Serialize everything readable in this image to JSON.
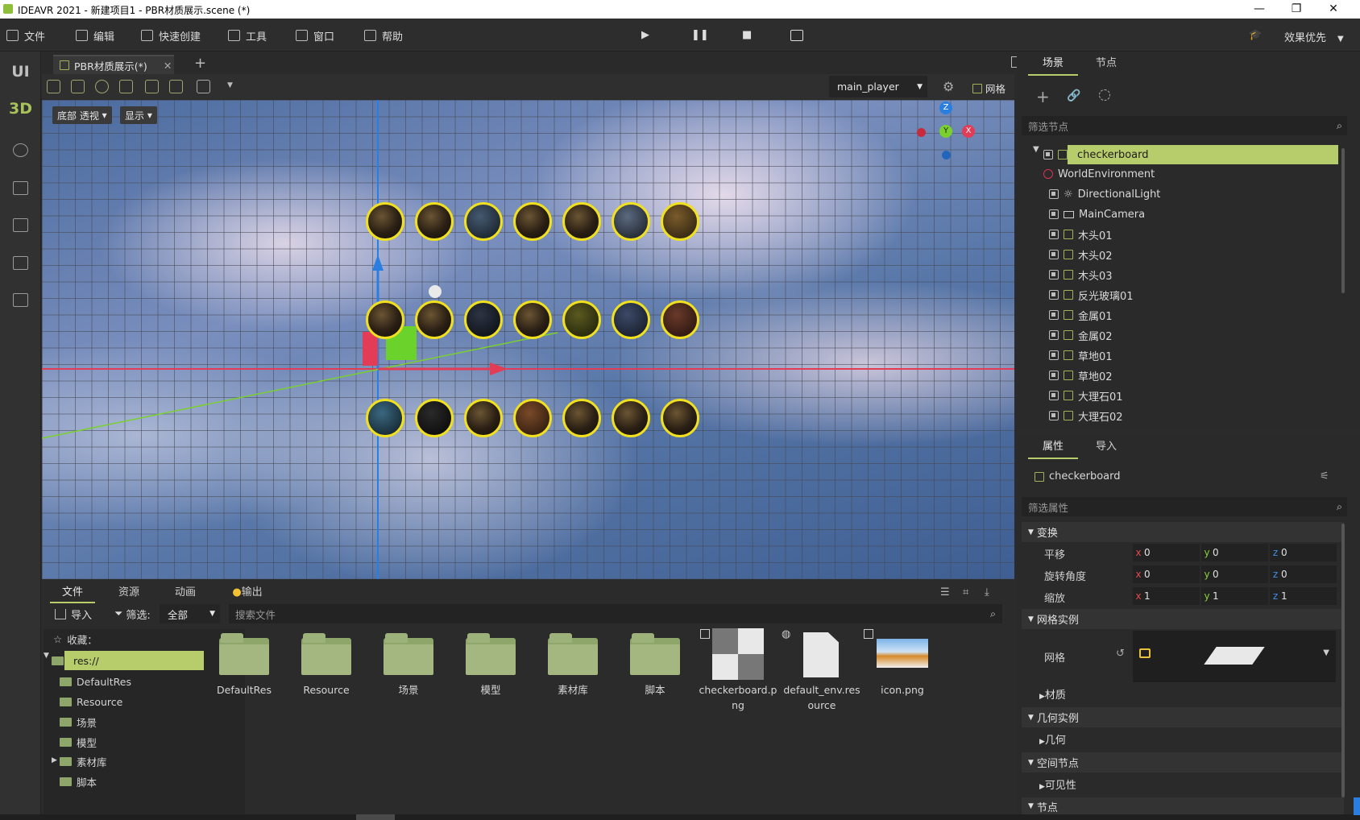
{
  "titlebar": {
    "title": "IDEAVR 2021 - 新建项目1 - PBR材质展示.scene (*)",
    "minimize": "—",
    "restore": "❐",
    "close": "✕"
  },
  "menu": {
    "items": [
      "文件",
      "编辑",
      "快速创建",
      "工具",
      "窗口",
      "帮助"
    ],
    "quality": "效果优先"
  },
  "left_bar": {
    "ui": "UI",
    "three_d": "3D"
  },
  "doc_tab": {
    "label": "PBR材质展示(*)",
    "close": "✕",
    "add": "+"
  },
  "viewport_toolbar": {
    "player": "main_player",
    "grid": "网格"
  },
  "viewport": {
    "perspective": "底部 透视",
    "display": "显示",
    "gizmo": {
      "z": "Z",
      "y": "Y",
      "x": "X"
    }
  },
  "scene_panel": {
    "tabs": [
      "场景",
      "节点"
    ],
    "filter_placeholder": "筛选节点",
    "nodes": [
      "checkerboard",
      "WorldEnvironment",
      "DirectionalLight",
      "MainCamera",
      "木头01",
      "木头02",
      "木头03",
      "反光玻璃01",
      "金属01",
      "金属02",
      "草地01",
      "草地02",
      "大理石01",
      "大理石02"
    ]
  },
  "props_panel": {
    "tabs": [
      "属性",
      "导入"
    ],
    "node_name": "checkerboard",
    "filter_placeholder": "筛选属性",
    "transform": "变换",
    "translate": {
      "label": "平移",
      "x": "0",
      "y": "0",
      "z": "0"
    },
    "rotation": {
      "label": "旋转角度",
      "x": "0",
      "y": "0",
      "z": "0"
    },
    "scale": {
      "label": "缩放",
      "x": "1",
      "y": "1",
      "z": "1"
    },
    "mesh_instance": "网格实例",
    "mesh_label": "网格",
    "material": "材质",
    "geometry_instance": "几何实例",
    "geometry": "几何",
    "spatial": "空间节点",
    "visibility": "可见性",
    "node": "节点",
    "axis": {
      "x": "x",
      "y": "y",
      "z": "z"
    }
  },
  "bottom_panel": {
    "tabs": [
      "文件",
      "资源",
      "动画",
      "输出"
    ],
    "import": "导入",
    "filter": "筛选:",
    "filter_value": "全部",
    "search_placeholder": "搜索文件",
    "favorites": "收藏：",
    "tree": [
      "res://",
      "DefaultRes",
      "Resource",
      "场景",
      "模型",
      "素材库",
      "脚本"
    ],
    "files": [
      "DefaultRes",
      "Resource",
      "场景",
      "模型",
      "素材库",
      "脚本"
    ],
    "file_checker_1": "checkerboard.p",
    "file_checker_2": "ng",
    "file_env_1": "default_env.res",
    "file_env_2": "ource",
    "file_icon": "icon.png"
  },
  "colors": {
    "accent": "#b7cc6a",
    "select_yellow": "#f0e020",
    "axis_red": "#e23c56",
    "axis_green": "#7ad12e",
    "axis_blue": "#2a7ee0"
  }
}
